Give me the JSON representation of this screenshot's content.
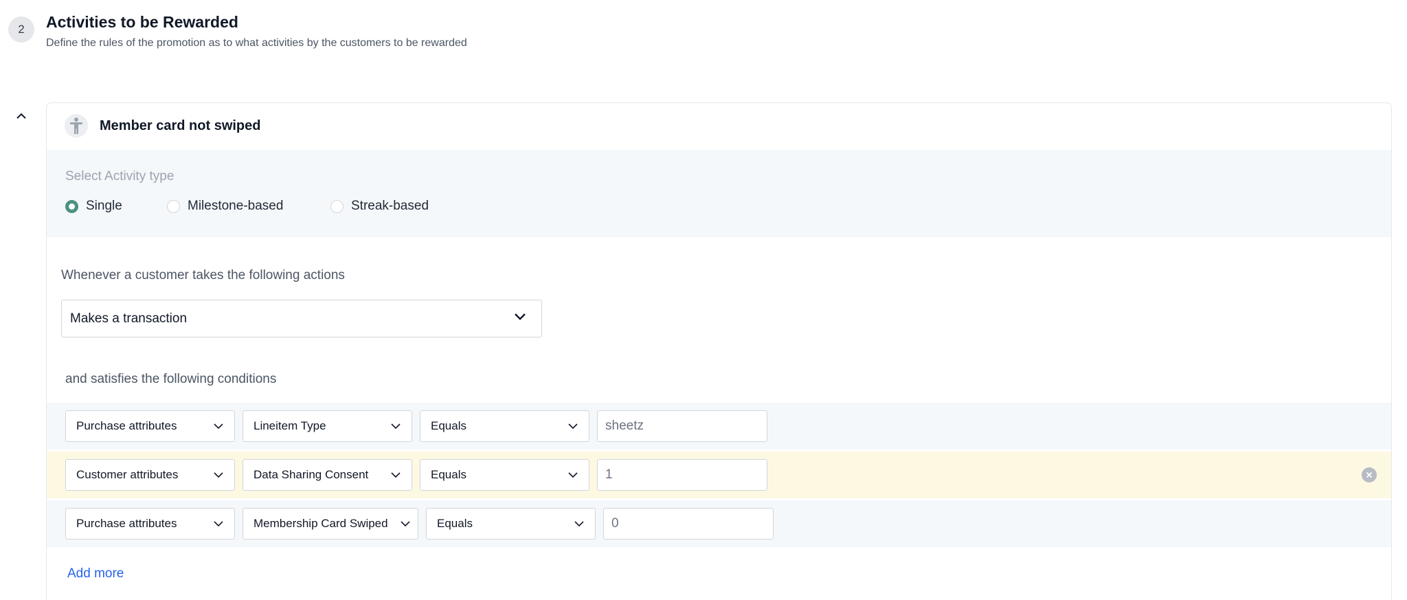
{
  "step": {
    "number": "2",
    "title": "Activities to be Rewarded",
    "subtitle": "Define the rules of the promotion as to what activities by the customers to be rewarded"
  },
  "card": {
    "title": "Member card not swiped",
    "icon": "person-accessibility-icon",
    "activity_type": {
      "label": "Select Activity type",
      "options": [
        "Single",
        "Milestone-based",
        "Streak-based"
      ],
      "selected": "Single"
    },
    "actions": {
      "label": "Whenever a customer takes the following actions",
      "selected": "Makes a transaction"
    },
    "conditions": {
      "label": "and satisfies the following conditions",
      "rows": [
        {
          "attribute_group": "Purchase attributes",
          "attribute": "Lineitem Type",
          "operator": "Equals",
          "value": "sheetz"
        },
        {
          "attribute_group": "Customer attributes",
          "attribute": "Data Sharing Consent",
          "operator": "Equals",
          "value": "1"
        },
        {
          "attribute_group": "Purchase attributes",
          "attribute": "Membership Card Swiped",
          "operator": "Equals",
          "value": "0"
        }
      ],
      "add_more_label": "Add more"
    }
  },
  "colors": {
    "radio_selected": "#4b9180",
    "link": "#2563eb",
    "highlight_row": "#fdf8e1",
    "panel_bg": "#f5f8fa"
  }
}
